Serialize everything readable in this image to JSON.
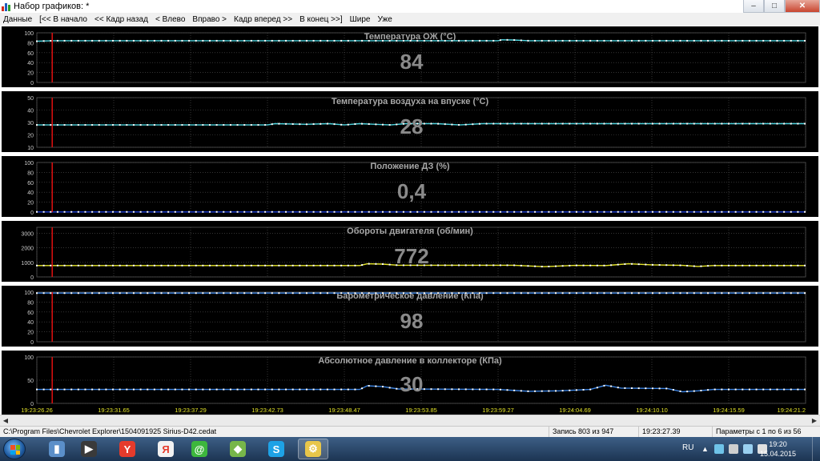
{
  "window": {
    "title": "Набор графиков: *",
    "controls": {
      "minimize": "–",
      "maximize": "□",
      "close": "✕"
    }
  },
  "menu": {
    "items": [
      "Данные",
      "[<< В начало",
      "<< Кадр назад",
      "< Влево",
      "Вправо >",
      "Кадр вперед >>",
      "В конец >>]",
      "Шире",
      "Уже"
    ]
  },
  "chart_data": [
    {
      "type": "line",
      "title": "Температура ОЖ  (°C)",
      "current_value": "84",
      "ylim": [
        0,
        100
      ],
      "yticks": [
        "100",
        "80",
        "60",
        "40",
        "20",
        "0"
      ],
      "x_labels": [
        "19:23:26.26",
        "19:23:31.65",
        "19:23:37.29",
        "19:23:42.73",
        "19:23:48.47",
        "19:23:53.85",
        "19:23:59.27",
        "19:24:04.69",
        "19:24:10.10",
        "19:24:15.59",
        "19:24:21.2"
      ],
      "cursor_x": "19:23:27.39",
      "series": [
        {
          "color": "#4dd2dc",
          "points": [
            [
              0,
              83
            ],
            [
              2,
              84
            ],
            [
              25,
              84
            ],
            [
              60,
              84
            ],
            [
              60.5,
              86
            ],
            [
              62,
              85.5
            ],
            [
              64,
              84
            ],
            [
              100,
              84
            ]
          ]
        }
      ]
    },
    {
      "type": "line",
      "title": "Температура воздуха на впуске  (°C)",
      "current_value": "28",
      "ylim": [
        10,
        50
      ],
      "yticks": [
        "50",
        "40",
        "30",
        "20",
        "10"
      ],
      "x_labels": [
        "19:23:26.26",
        "19:23:31.65",
        "19:23:37.29",
        "19:23:42.73",
        "19:23:48.47",
        "19:23:53.85",
        "19:23:59.27",
        "19:24:04.69",
        "19:24:10.10",
        "19:24:15.59",
        "19:24:21.2"
      ],
      "cursor_x": "19:23:27.39",
      "series": [
        {
          "color": "#4dd2dc",
          "points": [
            [
              0,
              28
            ],
            [
              30,
              28
            ],
            [
              31,
              29
            ],
            [
              35,
              28.5
            ],
            [
              38,
              29
            ],
            [
              40,
              28
            ],
            [
              42,
              29
            ],
            [
              44,
              28.5
            ],
            [
              46,
              28
            ],
            [
              48,
              29
            ],
            [
              52,
              29
            ],
            [
              55,
              28
            ],
            [
              58,
              29
            ],
            [
              100,
              29
            ]
          ]
        }
      ]
    },
    {
      "type": "line",
      "title": "Положение ДЗ  (%)",
      "current_value": "0,4",
      "ylim": [
        0,
        100
      ],
      "yticks": [
        "100",
        "80",
        "60",
        "40",
        "20",
        "0"
      ],
      "x_labels": [
        "19:23:26.26",
        "19:23:31.65",
        "19:23:37.29",
        "19:23:42.73",
        "19:23:48.47",
        "19:23:53.85",
        "19:23:59.27",
        "19:24:04.69",
        "19:24:10.10",
        "19:24:15.59",
        "19:24:21.2"
      ],
      "cursor_x": "19:23:27.39",
      "series": [
        {
          "color": "#1f3fd6",
          "points": [
            [
              0,
              0.4
            ],
            [
              100,
              0.4
            ]
          ]
        }
      ]
    },
    {
      "type": "line",
      "title": "Обороты двигателя  (об/мин)",
      "current_value": "772",
      "ylim": [
        0,
        3400
      ],
      "yticks": [
        "3000",
        "2000",
        "1000",
        "0"
      ],
      "x_labels": [
        "19:23:26.26",
        "19:23:31.65",
        "19:23:37.29",
        "19:23:42.73",
        "19:23:48.47",
        "19:23:53.85",
        "19:23:59.27",
        "19:24:04.69",
        "19:24:10.10",
        "19:24:15.59",
        "19:24:21.2"
      ],
      "cursor_x": "19:23:27.39",
      "series": [
        {
          "color": "#e6e62a",
          "points": [
            [
              0,
              780
            ],
            [
              42,
              780
            ],
            [
              43,
              900
            ],
            [
              45,
              880
            ],
            [
              47,
              800
            ],
            [
              62,
              800
            ],
            [
              66,
              700
            ],
            [
              70,
              790
            ],
            [
              74,
              780
            ],
            [
              77,
              900
            ],
            [
              80,
              830
            ],
            [
              84,
              790
            ],
            [
              86,
              720
            ],
            [
              88,
              780
            ],
            [
              100,
              780
            ]
          ]
        }
      ]
    },
    {
      "type": "line",
      "title": "Барометрическое давление  (КПа)",
      "current_value": "98",
      "ylim": [
        0,
        100
      ],
      "yticks": [
        "100",
        "80",
        "60",
        "40",
        "20",
        "0"
      ],
      "x_labels": [
        "19:23:26.26",
        "19:23:31.65",
        "19:23:37.29",
        "19:23:42.73",
        "19:23:48.47",
        "19:23:53.85",
        "19:23:59.27",
        "19:24:04.69",
        "19:24:10.10",
        "19:24:15.59",
        "19:24:21.2"
      ],
      "cursor_x": "19:23:27.39",
      "series": [
        {
          "color": "#3b82e0",
          "points": [
            [
              0,
              98
            ],
            [
              100,
              98
            ]
          ]
        }
      ]
    },
    {
      "type": "line",
      "title": "Абсолютное давление в коллекторе  (КПа)",
      "current_value": "30",
      "ylim": [
        0,
        100
      ],
      "yticks": [
        "100",
        "50",
        "0"
      ],
      "x_labels": [
        "19:23:26.26",
        "19:23:31.65",
        "19:23:37.29",
        "19:23:42.73",
        "19:23:48.47",
        "19:23:53.85",
        "19:23:59.27",
        "19:24:04.69",
        "19:24:10.10",
        "19:24:15.59",
        "19:24:21.2"
      ],
      "cursor_x": "19:23:27.39",
      "series": [
        {
          "color": "#3b82e0",
          "points": [
            [
              0,
              30
            ],
            [
              42,
              30
            ],
            [
              43,
              38
            ],
            [
              45,
              36
            ],
            [
              47,
              31
            ],
            [
              60,
              30
            ],
            [
              64,
              26
            ],
            [
              68,
              27
            ],
            [
              72,
              30
            ],
            [
              74,
              39
            ],
            [
              76,
              33
            ],
            [
              82,
              32
            ],
            [
              84,
              25
            ],
            [
              86,
              27
            ],
            [
              88,
              30
            ],
            [
              100,
              30
            ]
          ]
        }
      ]
    }
  ],
  "status": {
    "file": "C:\\Program Files\\Chevrolet Explorer\\1504091925 Sirius-D42.cedat",
    "record": "Запись 803 из 947",
    "time": "19:23:27.39",
    "params": "Параметры с 1 по 6 из 56"
  },
  "taskbar": {
    "apps": [
      {
        "name": "file-explorer",
        "glyph": "▮",
        "color": "#5b8fc9"
      },
      {
        "name": "media-player",
        "glyph": "▶",
        "color": "#3a3a3a"
      },
      {
        "name": "yandex-browser",
        "glyph": "Y",
        "color": "#e53b2c"
      },
      {
        "name": "yandex",
        "glyph": "Я",
        "color": "#f2f2f2"
      },
      {
        "name": "icq",
        "glyph": "@",
        "color": "#3db73d"
      },
      {
        "name": "android-app",
        "glyph": "◆",
        "color": "#77b64a"
      },
      {
        "name": "skype",
        "glyph": "S",
        "color": "#1ea2e6"
      },
      {
        "name": "chevrolet-explorer",
        "glyph": "⚙",
        "color": "#e8c64a"
      }
    ],
    "lang": "RU",
    "clock_time": "19:20",
    "clock_date": "15.04.2015"
  },
  "colors": {
    "panel_bg": "#000000",
    "grid": "#555555",
    "axis_text": "#cccccc",
    "title_text": "#a8a8a8",
    "value_text": "#8a8a8a",
    "cursor": "#e01010"
  }
}
